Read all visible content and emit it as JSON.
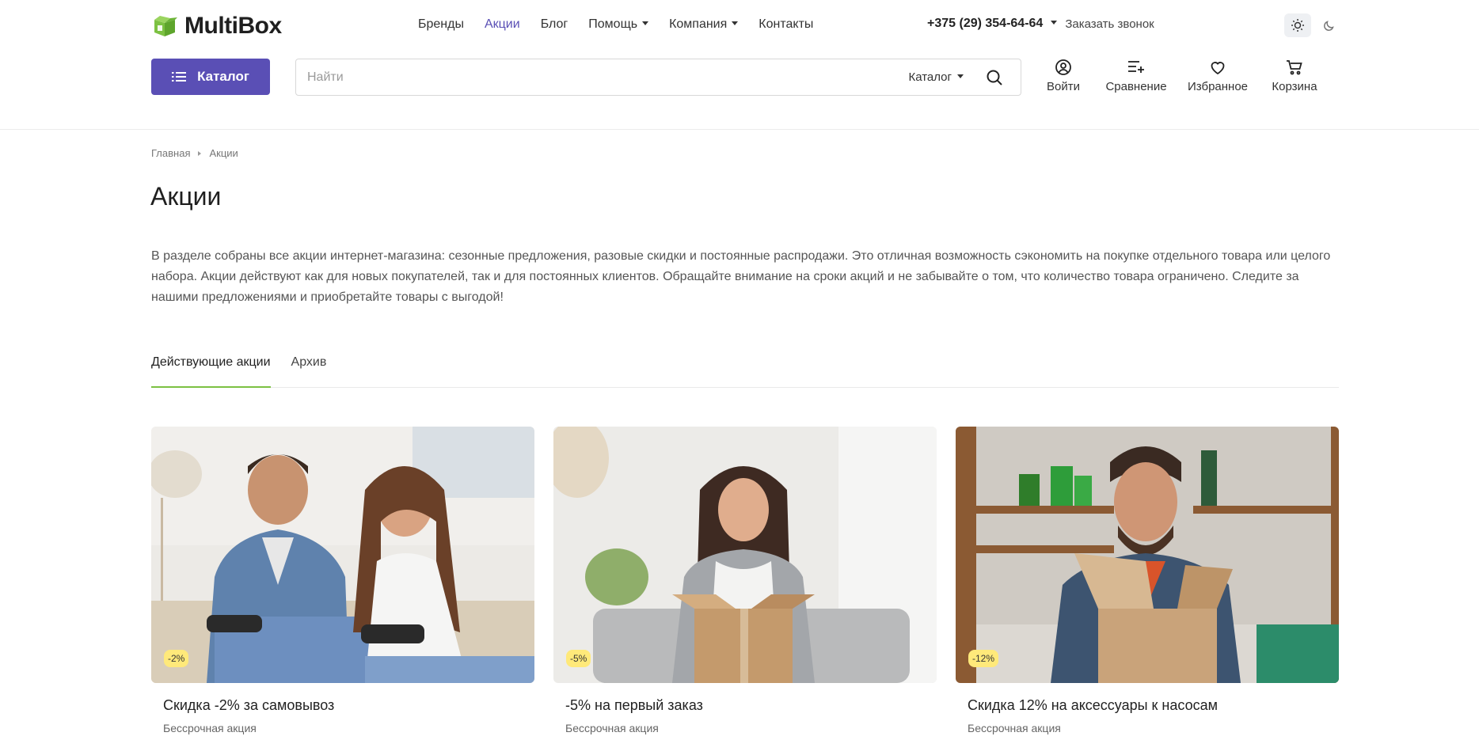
{
  "brand": {
    "name": "MultiBox",
    "accent": "#5a4fb5",
    "logo_green": "#7cc142"
  },
  "nav": {
    "items": [
      {
        "label": "Бренды",
        "dropdown": false,
        "active": false
      },
      {
        "label": "Акции",
        "dropdown": false,
        "active": true
      },
      {
        "label": "Блог",
        "dropdown": false,
        "active": false
      },
      {
        "label": "Помощь",
        "dropdown": true,
        "active": false
      },
      {
        "label": "Компания",
        "dropdown": true,
        "active": false
      },
      {
        "label": "Контакты",
        "dropdown": false,
        "active": false
      }
    ]
  },
  "contact": {
    "phone": "+375 (29) 354-64-64",
    "callback_label": "Заказать звонок"
  },
  "theme": {
    "light_icon": "sun-icon",
    "dark_icon": "moon-icon",
    "active": "light"
  },
  "catalog_button": {
    "label": "Каталог",
    "icon": "list-icon"
  },
  "search": {
    "placeholder": "Найти",
    "category_label": "Каталог",
    "icon": "search-icon"
  },
  "header_actions": [
    {
      "label": "Войти",
      "icon": "user-icon"
    },
    {
      "label": "Сравнение",
      "icon": "compare-icon"
    },
    {
      "label": "Избранное",
      "icon": "heart-icon"
    },
    {
      "label": "Корзина",
      "icon": "cart-icon"
    }
  ],
  "breadcrumb": [
    "Главная",
    "Акции"
  ],
  "page": {
    "title": "Акции",
    "intro": "В разделе собраны все акции интернет-магазина: сезонные предложения, разовые скидки и постоянные распродажи. Это отличная возможность сэкономить на покупке отдельного товара или целого набора. Акции действуют как для новых покупателей, так и для постоянных клиентов. Обращайте внимание на сроки акций и не забывайте о том, что количество товара ограничено. Следите за нашими предложениями и приобретайте товары с выгодой!"
  },
  "tabs": [
    {
      "label": "Действующие акции",
      "active": true
    },
    {
      "label": "Архив",
      "active": false
    }
  ],
  "promos": [
    {
      "badge": "-2%",
      "title": "Скидка -2% за самовывоз",
      "subtitle": "Бессрочная акция"
    },
    {
      "badge": "-5%",
      "title": "-5% на первый заказ",
      "subtitle": "Бессрочная акция"
    },
    {
      "badge": "-12%",
      "title": "Скидка 12% на аксессуары к насосам",
      "subtitle": "Бессрочная акция"
    }
  ]
}
